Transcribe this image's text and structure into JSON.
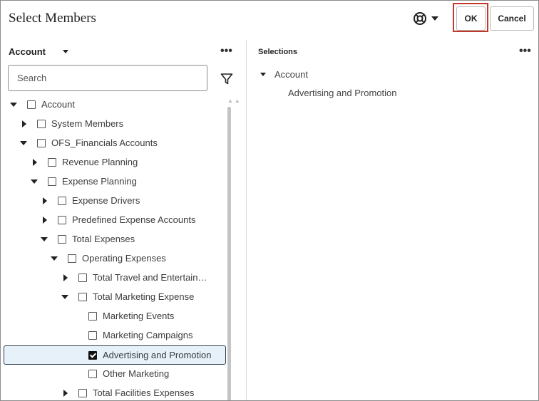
{
  "dialog": {
    "title": "Select Members",
    "help_icon": "lifebuoy-icon",
    "ok_label": "OK",
    "cancel_label": "Cancel",
    "accent_highlight": "#c0392b"
  },
  "left_panel": {
    "dimension_label": "Account",
    "more_label": "•••",
    "search": {
      "placeholder": "Search",
      "value": ""
    },
    "filter_icon": "filter-icon",
    "tree": [
      {
        "label": "Account",
        "expanded": true,
        "checked": false
      },
      {
        "label": "System Members",
        "expanded": false,
        "checked": false
      },
      {
        "label": "OFS_Financials Accounts",
        "expanded": true,
        "checked": false
      },
      {
        "label": "Revenue Planning",
        "expanded": false,
        "checked": false
      },
      {
        "label": "Expense Planning",
        "expanded": true,
        "checked": false
      },
      {
        "label": "Expense Drivers",
        "expanded": false,
        "checked": false
      },
      {
        "label": "Predefined Expense Accounts",
        "expanded": false,
        "checked": false
      },
      {
        "label": "Total Expenses",
        "expanded": true,
        "checked": false
      },
      {
        "label": "Operating Expenses",
        "expanded": true,
        "checked": false
      },
      {
        "label": "Total Travel and Entertain…",
        "expanded": false,
        "checked": false
      },
      {
        "label": "Total Marketing Expense",
        "expanded": true,
        "checked": false
      },
      {
        "label": "Marketing Events",
        "checked": false
      },
      {
        "label": "Marketing Campaigns",
        "checked": false
      },
      {
        "label": "Advertising and Promotion",
        "checked": true,
        "selected": true
      },
      {
        "label": "Other Marketing",
        "checked": false
      },
      {
        "label": "Total Facilities Expenses",
        "expanded": false,
        "checked": false
      }
    ]
  },
  "right_panel": {
    "heading": "Selections",
    "more_label": "•••",
    "group_label": "Account",
    "items": [
      "Advertising and Promotion"
    ]
  }
}
